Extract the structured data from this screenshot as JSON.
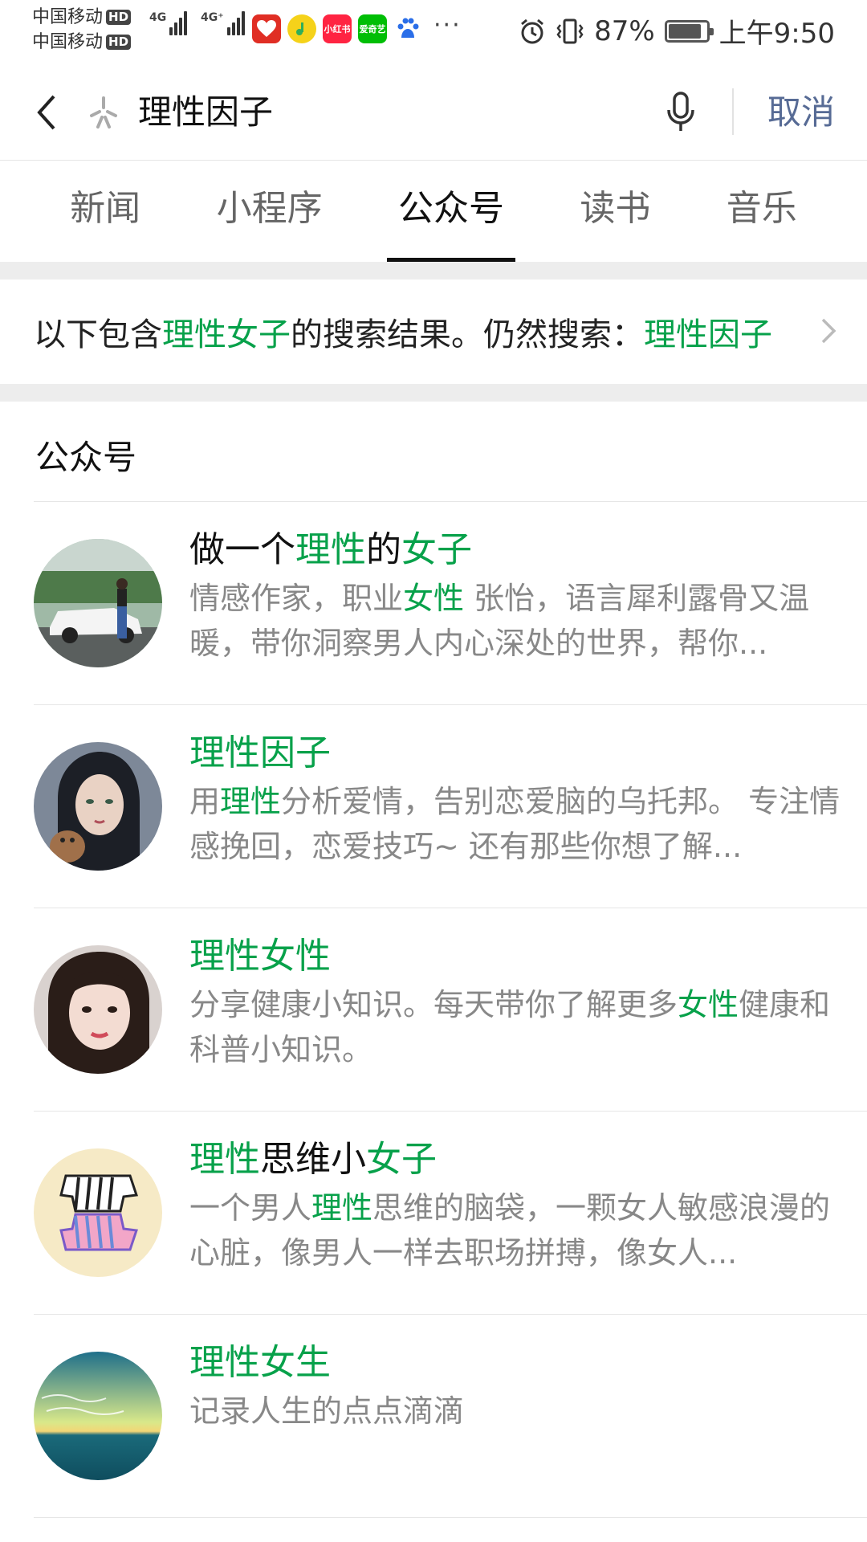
{
  "status_bar": {
    "carrier_1": "中国移动",
    "carrier_2": "中国移动",
    "hd_badge": "HD",
    "net_1": "4G",
    "net_2": "4G⁺",
    "app_icons": [
      {
        "name": "pinduoduo-icon",
        "color": "#e02e24"
      },
      {
        "name": "qq-music-icon",
        "color": "#f5d21a"
      },
      {
        "name": "xiaohongshu-icon",
        "color": "#ff2442",
        "text": "小红书"
      },
      {
        "name": "iqiyi-icon",
        "color": "#00be06",
        "text": "爱奇艺"
      },
      {
        "name": "baidu-icon",
        "color": "#2a6ee8"
      }
    ],
    "more": "···",
    "battery_percent": "87%",
    "battery_level": 0.87,
    "time": "上午9:50"
  },
  "search": {
    "query": "理性因子",
    "cancel_label": "取消"
  },
  "tabs": [
    {
      "label": "新闻",
      "active": false
    },
    {
      "label": "小程序",
      "active": false
    },
    {
      "label": "公众号",
      "active": true
    },
    {
      "label": "读书",
      "active": false
    },
    {
      "label": "音乐",
      "active": false
    }
  ],
  "correction": {
    "prefix": "以下包含 ",
    "corrected_term": "理性女子",
    "middle": " 的搜索结果。仍然搜索：",
    "original_term": "理性因子"
  },
  "section_title": "公众号",
  "results": [
    {
      "title_parts": [
        {
          "text": "做一个",
          "hl": false
        },
        {
          "text": "理性",
          "hl": true
        },
        {
          "text": "的",
          "hl": false
        },
        {
          "text": "女子",
          "hl": true
        }
      ],
      "desc_parts": [
        {
          "text": "情感作家，职业",
          "hl": false
        },
        {
          "text": "女性",
          "hl": true
        },
        {
          "text": " 张怡，语言犀利露骨又温暖，带你洞察男人内心深处的世界，帮你...",
          "hl": false
        }
      ],
      "avatar": "car-photo"
    },
    {
      "title_parts": [
        {
          "text": "理性因子",
          "hl": true
        }
      ],
      "desc_parts": [
        {
          "text": "用",
          "hl": false
        },
        {
          "text": "理性",
          "hl": true
        },
        {
          "text": "分析爱情，告别恋爱脑的乌托邦。 专注情感挽回，恋爱技巧~ 还有那些你想了解...",
          "hl": false
        }
      ],
      "avatar": "girl-illustration"
    },
    {
      "title_parts": [
        {
          "text": "理性女性",
          "hl": true
        }
      ],
      "desc_parts": [
        {
          "text": "分享健康小知识。每天带你了解更多",
          "hl": false
        },
        {
          "text": "女性",
          "hl": true
        },
        {
          "text": "健康和科普小知识。",
          "hl": false
        }
      ],
      "avatar": "portrait-photo"
    },
    {
      "title_parts": [
        {
          "text": "理性",
          "hl": true
        },
        {
          "text": "思维小",
          "hl": false
        },
        {
          "text": "女子",
          "hl": true
        }
      ],
      "desc_parts": [
        {
          "text": "一个男人",
          "hl": false
        },
        {
          "text": "理性",
          "hl": true
        },
        {
          "text": "思维的脑袋，一颗女人敏感浪漫的心脏，像男人一样去职场拼搏，像女人...",
          "hl": false
        }
      ],
      "avatar": "zebra-art"
    },
    {
      "title_parts": [
        {
          "text": "理性女生",
          "hl": true
        }
      ],
      "desc_parts": [
        {
          "text": "记录人生的点点滴滴",
          "hl": false
        }
      ],
      "avatar": "sunset-sea"
    }
  ],
  "colors": {
    "highlight": "#07a14a",
    "cancel": "#576b95",
    "separator": "#ededed"
  }
}
